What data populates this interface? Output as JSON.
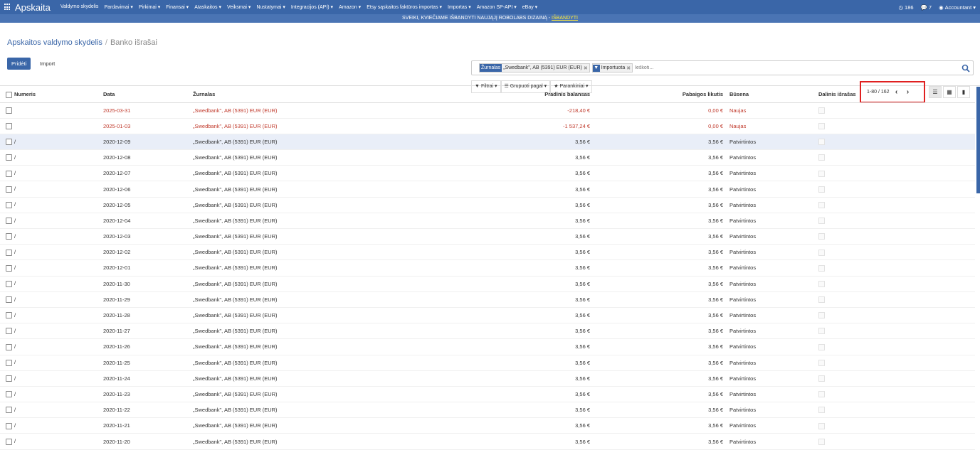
{
  "nav": {
    "brand": "Apskaita",
    "menu": [
      "Valdymo skydelis",
      "Pardavimai ▾",
      "Pirkimai ▾",
      "Finansai ▾",
      "Ataskaitos ▾",
      "Veiksmai ▾",
      "Nustatymai ▾",
      "Integracijos (API) ▾",
      "Amazon ▾",
      "Etsy sąskaitos faktūros importas ▾",
      "Importas ▾",
      "Amazon SP-API ▾",
      "eBay ▾"
    ],
    "activity_count": "186",
    "messages_count": "7",
    "user": "Accountant ▾"
  },
  "banner": {
    "text": "SVEIKI, KVIEČIAME IŠBANDYTI NAUJĄJĮ ROBOLABS DIZAINĄ - ",
    "link": "IŠBANDYTI"
  },
  "breadcrumb": {
    "parent": "Apskaitos valdymo skydelis",
    "current": "Banko išrašai"
  },
  "buttons": {
    "create": "Pridėti",
    "import": "Import"
  },
  "search": {
    "facets": [
      {
        "key": "Žurnalas",
        "value": "„Swedbank\", AB (5391) EUR (EUR)"
      },
      {
        "key": "",
        "value": "Importuota"
      }
    ],
    "placeholder": "Ieškoti..."
  },
  "filter_bar": {
    "filters": "Filtrai ▾",
    "group": "Grupuoti pagal ▾",
    "favorites": "Parankiniai ▾"
  },
  "pager": {
    "value": "1-80 / 162"
  },
  "table": {
    "headers": [
      "Numeris",
      "Data",
      "Žurnalas",
      "Pradinis balansas",
      "Pabaigos likutis",
      "Būsena",
      "Dalinis išrašas"
    ],
    "rows": [
      {
        "num": "",
        "date": "2025-03-31",
        "journal": "„Swedbank\", AB (5391) EUR (EUR)",
        "start": "-218,40 €",
        "end": "0,00 €",
        "status": "Naujas",
        "red": true
      },
      {
        "num": "",
        "date": "2025-01-03",
        "journal": "„Swedbank\", AB (5391) EUR (EUR)",
        "start": "-1 537,24 €",
        "end": "0,00 €",
        "status": "Naujas",
        "red": true
      },
      {
        "num": "/",
        "date": "2020-12-09",
        "journal": "„Swedbank\", AB (5391) EUR (EUR)",
        "start": "3,56 €",
        "end": "3,56 €",
        "status": "Patvirtintos",
        "selected": true
      },
      {
        "num": "/",
        "date": "2020-12-08",
        "journal": "„Swedbank\", AB (5391) EUR (EUR)",
        "start": "3,56 €",
        "end": "3,56 €",
        "status": "Patvirtintos"
      },
      {
        "num": "/",
        "date": "2020-12-07",
        "journal": "„Swedbank\", AB (5391) EUR (EUR)",
        "start": "3,56 €",
        "end": "3,56 €",
        "status": "Patvirtintos"
      },
      {
        "num": "/",
        "date": "2020-12-06",
        "journal": "„Swedbank\", AB (5391) EUR (EUR)",
        "start": "3,56 €",
        "end": "3,56 €",
        "status": "Patvirtintos"
      },
      {
        "num": "/",
        "date": "2020-12-05",
        "journal": "„Swedbank\", AB (5391) EUR (EUR)",
        "start": "3,56 €",
        "end": "3,56 €",
        "status": "Patvirtintos"
      },
      {
        "num": "/",
        "date": "2020-12-04",
        "journal": "„Swedbank\", AB (5391) EUR (EUR)",
        "start": "3,56 €",
        "end": "3,56 €",
        "status": "Patvirtintos"
      },
      {
        "num": "/",
        "date": "2020-12-03",
        "journal": "„Swedbank\", AB (5391) EUR (EUR)",
        "start": "3,56 €",
        "end": "3,56 €",
        "status": "Patvirtintos"
      },
      {
        "num": "/",
        "date": "2020-12-02",
        "journal": "„Swedbank\", AB (5391) EUR (EUR)",
        "start": "3,56 €",
        "end": "3,56 €",
        "status": "Patvirtintos"
      },
      {
        "num": "/",
        "date": "2020-12-01",
        "journal": "„Swedbank\", AB (5391) EUR (EUR)",
        "start": "3,56 €",
        "end": "3,56 €",
        "status": "Patvirtintos"
      },
      {
        "num": "/",
        "date": "2020-11-30",
        "journal": "„Swedbank\", AB (5391) EUR (EUR)",
        "start": "3,56 €",
        "end": "3,56 €",
        "status": "Patvirtintos"
      },
      {
        "num": "/",
        "date": "2020-11-29",
        "journal": "„Swedbank\", AB (5391) EUR (EUR)",
        "start": "3,56 €",
        "end": "3,56 €",
        "status": "Patvirtintos"
      },
      {
        "num": "/",
        "date": "2020-11-28",
        "journal": "„Swedbank\", AB (5391) EUR (EUR)",
        "start": "3,56 €",
        "end": "3,56 €",
        "status": "Patvirtintos"
      },
      {
        "num": "/",
        "date": "2020-11-27",
        "journal": "„Swedbank\", AB (5391) EUR (EUR)",
        "start": "3,56 €",
        "end": "3,56 €",
        "status": "Patvirtintos"
      },
      {
        "num": "/",
        "date": "2020-11-26",
        "journal": "„Swedbank\", AB (5391) EUR (EUR)",
        "start": "3,56 €",
        "end": "3,56 €",
        "status": "Patvirtintos"
      },
      {
        "num": "/",
        "date": "2020-11-25",
        "journal": "„Swedbank\", AB (5391) EUR (EUR)",
        "start": "3,56 €",
        "end": "3,56 €",
        "status": "Patvirtintos"
      },
      {
        "num": "/",
        "date": "2020-11-24",
        "journal": "„Swedbank\", AB (5391) EUR (EUR)",
        "start": "3,56 €",
        "end": "3,56 €",
        "status": "Patvirtintos"
      },
      {
        "num": "/",
        "date": "2020-11-23",
        "journal": "„Swedbank\", AB (5391) EUR (EUR)",
        "start": "3,56 €",
        "end": "3,56 €",
        "status": "Patvirtintos"
      },
      {
        "num": "/",
        "date": "2020-11-22",
        "journal": "„Swedbank\", AB (5391) EUR (EUR)",
        "start": "3,56 €",
        "end": "3,56 €",
        "status": "Patvirtintos"
      },
      {
        "num": "/",
        "date": "2020-11-21",
        "journal": "„Swedbank\", AB (5391) EUR (EUR)",
        "start": "3,56 €",
        "end": "3,56 €",
        "status": "Patvirtintos"
      },
      {
        "num": "/",
        "date": "2020-11-20",
        "journal": "„Swedbank\", AB (5391) EUR (EUR)",
        "start": "3,56 €",
        "end": "3,56 €",
        "status": "Patvirtintos"
      }
    ]
  },
  "colors": {
    "nav": "#3a66a8",
    "banner": "#4a74b4",
    "highlight": "#e02020",
    "new_row": "#c0392b"
  }
}
